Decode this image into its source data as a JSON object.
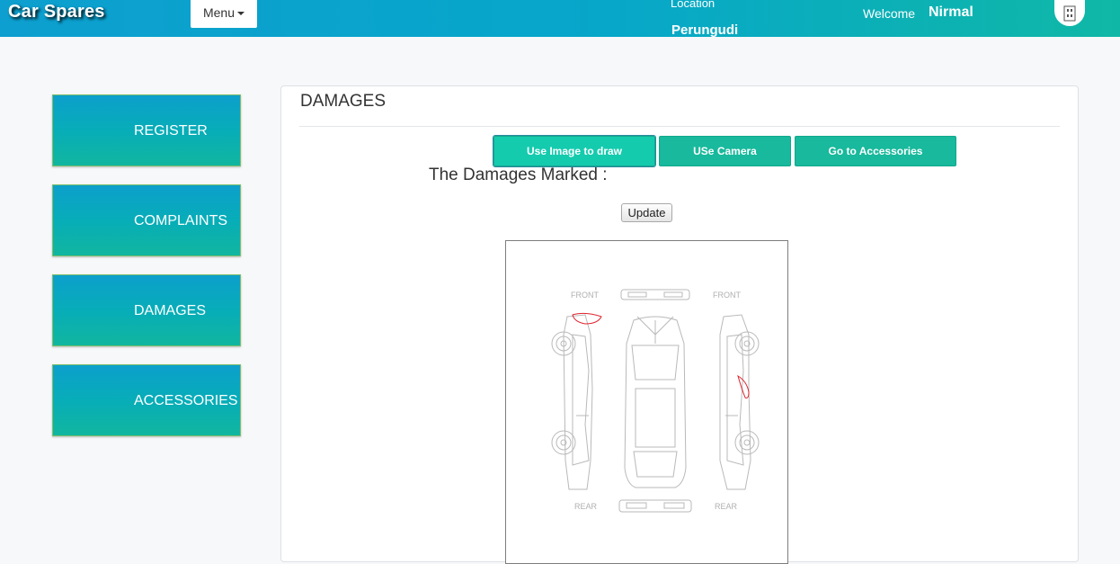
{
  "header": {
    "brand": "Car Spares",
    "menu_label": "Menu",
    "location_label": "Location",
    "location_value": "Perungudi",
    "welcome_label": "Welcome",
    "user_name": "Nirmal",
    "colors": {
      "gradient_start": "#0d9fcf",
      "gradient_end": "#0fb8a6"
    }
  },
  "sidebar": {
    "items": [
      {
        "label": "REGISTER"
      },
      {
        "label": "COMPLAINTS"
      },
      {
        "label": "DAMAGES"
      },
      {
        "label": "ACCESSORIES"
      }
    ]
  },
  "main": {
    "title": "DAMAGES",
    "actions": [
      {
        "label": "Use Image to draw",
        "active": true
      },
      {
        "label": "USe Camera"
      },
      {
        "label": "Go to Accessories"
      }
    ],
    "marked_label": "The Damages Marked :",
    "update_label": "Update",
    "diagram": {
      "front_left_label": "FRONT",
      "front_right_label": "FRONT",
      "rear_left_label": "REAR",
      "rear_right_label": "REAR",
      "damage_marks": 2,
      "damage_color": "#e0242f"
    }
  }
}
